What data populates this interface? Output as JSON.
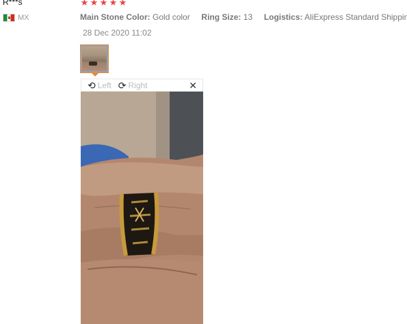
{
  "reviewer": {
    "name": "R***s",
    "country_code": "MX",
    "flag_icon": "mexico-flag-icon"
  },
  "rating": {
    "stars": 5,
    "max": 5,
    "color": "#e64545"
  },
  "attributes": [
    {
      "key": "Main Stone Color:",
      "value": "Gold color"
    },
    {
      "key": "Ring Size:",
      "value": "13"
    },
    {
      "key": "Logistics:",
      "value": "AliExpress Standard Shipping"
    }
  ],
  "date": "28 Dec 2020 11:02",
  "viewer": {
    "rotate_left_label": "Left",
    "rotate_right_label": "Right",
    "rotate_left_icon": "rotate-left-icon",
    "rotate_right_icon": "rotate-right-icon",
    "close_icon": "close-icon"
  },
  "accent_color": "#e58a3a"
}
